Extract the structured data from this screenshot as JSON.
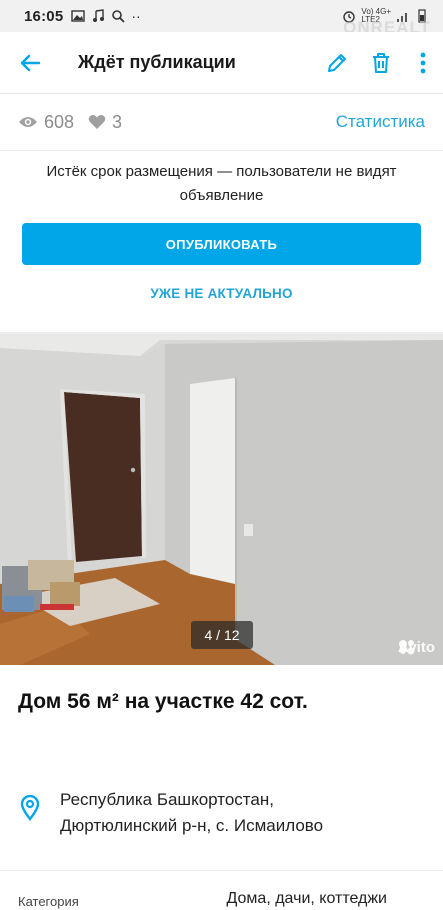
{
  "status_bar": {
    "time": "16:05",
    "network": "Vo) 4G+\nLTE2",
    "watermark": "ONREALT"
  },
  "app_bar": {
    "title": "Ждёт публикации"
  },
  "stats": {
    "views": "608",
    "likes": "3",
    "link": "Статистика"
  },
  "notice": {
    "text": "Истёк срок размещения — пользователи не видят объявление",
    "publish_label": "ОПУБЛИКОВАТЬ",
    "inactive_label": "УЖЕ НЕ АКТУАЛЬНО"
  },
  "photo": {
    "counter": "4 / 12",
    "watermark": "Avito"
  },
  "listing": {
    "title": "Дом 56 м² на участке 42 сот.",
    "location_line1": "Республика Башкортостан,",
    "location_line2": "Дюртюлинский р-н, с. Исмаилово",
    "category_label": "Категория",
    "category_value": "Дома, дачи, коттеджи"
  },
  "colors": {
    "accent": "#00a6e8",
    "link": "#22a5d6"
  }
}
